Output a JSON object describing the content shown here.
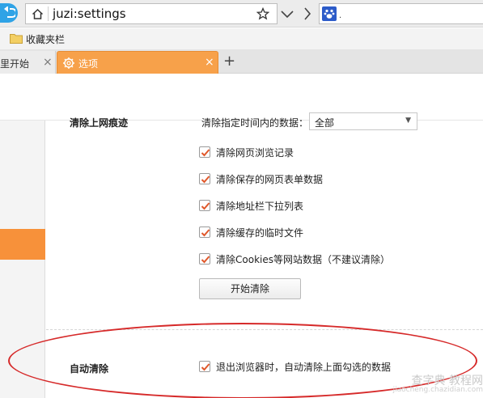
{
  "address_bar": {
    "url": "juzi:settings",
    "search_text": "."
  },
  "bookmarks_bar": {
    "folder_label": "收藏夹栏"
  },
  "tabs": [
    {
      "label": "里开始",
      "close": "×"
    },
    {
      "label": "选项",
      "close": "×",
      "active": true
    }
  ],
  "new_tab_label": "+",
  "clear_history": {
    "title": "清除上网痕迹",
    "range_label": "清除指定时间内的数据：",
    "range_value": "全部",
    "options": [
      {
        "label": "清除网页浏览记录",
        "checked": true
      },
      {
        "label": "清除保存的网页表单数据",
        "checked": true
      },
      {
        "label": "清除地址栏下拉列表",
        "checked": true
      },
      {
        "label": "清除缓存的临时文件",
        "checked": true
      },
      {
        "label": "清除Cookies等网站数据（不建议清除）",
        "checked": true
      }
    ],
    "start_button": "开始清除"
  },
  "auto_clear": {
    "title": "自动清除",
    "option": {
      "label": "退出浏览器时，自动清除上面勾选的数据",
      "checked": true
    }
  },
  "watermark": {
    "line1": "查字典 教程网",
    "line2": "jiaocheng.chazidian.com"
  },
  "colors": {
    "accent": "#f7913a",
    "active_tab": "#f7a14a",
    "back_button": "#2fa3e6",
    "annotation": "#d62a2a"
  },
  "icons": [
    "back-arrow-icon",
    "home-icon",
    "star-icon",
    "chevron-down-icon",
    "chevron-right-icon",
    "paw-icon",
    "folder-icon",
    "gear-icon",
    "checkmark-icon"
  ]
}
